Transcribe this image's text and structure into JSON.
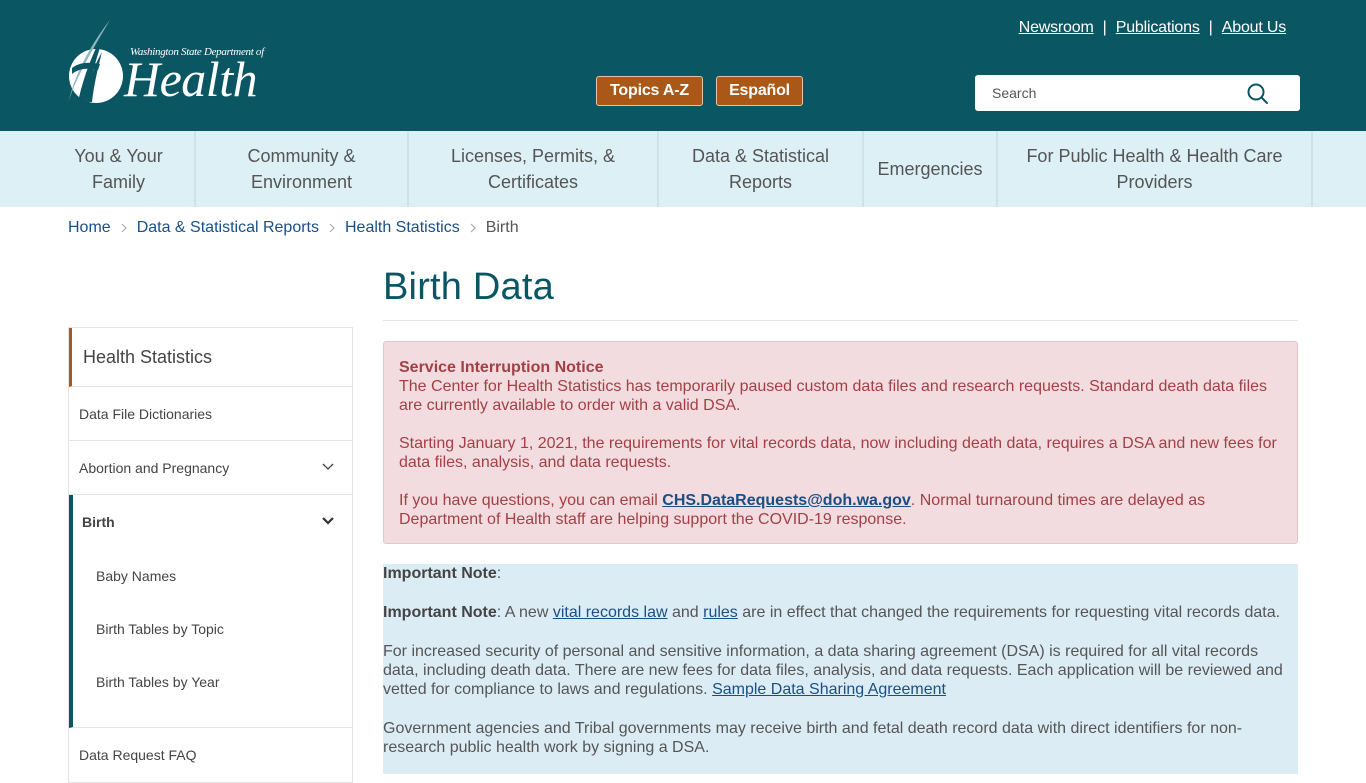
{
  "header": {
    "logo": {
      "org_line": "Washington State Department of",
      "name": "Health"
    },
    "utility_links": [
      "Newsroom",
      "Publications",
      "About Us"
    ],
    "buttons": {
      "topics": "Topics A-Z",
      "espanol": "Español"
    },
    "search": {
      "placeholder": "Search",
      "value": ""
    },
    "colors": {
      "header_bg": "#0b5663",
      "button_bg": "#a95818",
      "nav_bg": "#dcf0f6"
    }
  },
  "mainnav": {
    "items": [
      {
        "line1": "You & Your",
        "line2": "Family"
      },
      {
        "line1": "Community &",
        "line2": "Environment"
      },
      {
        "line1": "Licenses, Permits, &",
        "line2": "Certificates"
      },
      {
        "line1": "Data & Statistical",
        "line2": "Reports"
      },
      {
        "line1": "Emergencies",
        "line2": ""
      },
      {
        "line1": "For Public Health & Health Care",
        "line2": "Providers"
      }
    ]
  },
  "breadcrumb": {
    "items": [
      "Home",
      "Data & Statistical Reports",
      "Health Statistics"
    ],
    "current": "Birth"
  },
  "sidebar": {
    "heading": "Health Statistics",
    "items": [
      {
        "label": "Data File Dictionaries"
      },
      {
        "label": "Abortion and Pregnancy",
        "expandable": true
      },
      {
        "label": "Birth",
        "expandable": true,
        "active": true,
        "children": [
          "Baby Names",
          "Birth Tables by Topic",
          "Birth Tables by Year"
        ]
      },
      {
        "label": "Data Request FAQ"
      }
    ]
  },
  "content": {
    "title": "Birth Data",
    "alert": {
      "title": "Service Interruption Notice",
      "p1": "The Center for Health Statistics has temporarily paused custom data files and research requests. Standard death data files are currently available to order with a valid DSA.",
      "p2": "Starting January 1, 2021, the requirements for vital records data, now including death data, requires a DSA and new fees for data files, analysis, and data requests.",
      "p3_before": "If you have questions, you can email ",
      "p3_link": "CHS.DataRequests@doh.wa.gov",
      "p3_after": ". Normal turnaround times are delayed as Department of Health staff are helping support the COVID-19 response."
    },
    "note": {
      "heading_label": "Important Note",
      "heading_suffix": ":",
      "p1_label": "Important Note",
      "p1_a": ": A new ",
      "p1_link1": "vital records law",
      "p1_b": " and ",
      "p1_link2": "rules",
      "p1_c": " are in effect that changed the requirements for requesting vital records data.",
      "p2_text": "For increased security of personal and sensitive information, a data sharing agreement (DSA) is required for all vital records data, including death data. There are new fees for data files, analysis, and data requests. Each application will be reviewed and vetted for compliance to laws and regulations. ",
      "p2_link": "Sample Data Sharing Agreement",
      "p3_text": "Government agencies and Tribal governments may receive birth and fetal death record data with direct identifiers for non-research public health work by signing a DSA."
    }
  }
}
